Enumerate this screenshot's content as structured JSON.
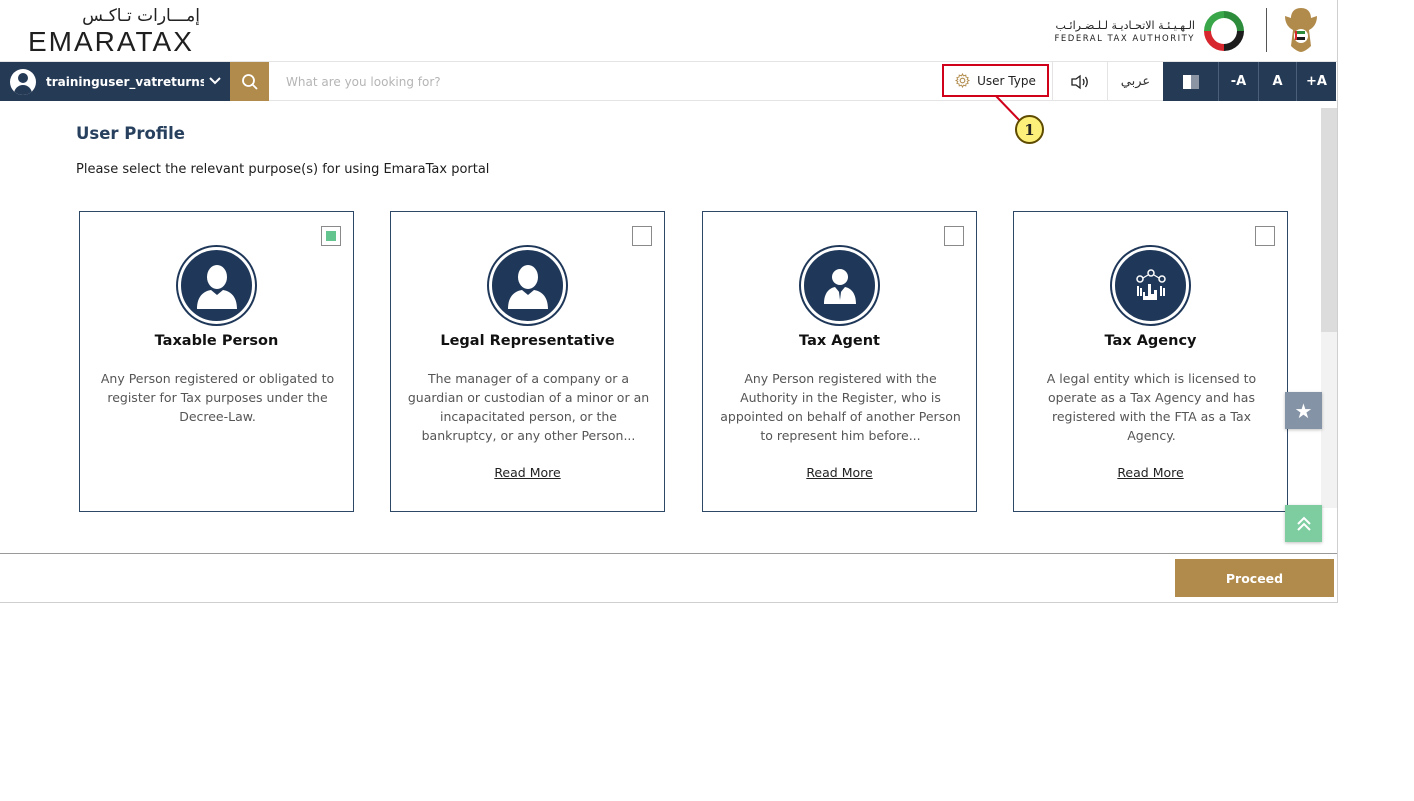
{
  "header": {
    "brand_ar": "إمـــارات تـاكـس",
    "brand_en": "EMARATAX",
    "authority_ar": "الـهـيـئـة الاتحـاديـة لـلـضـرائـب",
    "authority_en": "FEDERAL TAX AUTHORITY"
  },
  "toolbar": {
    "username": "traininguser_vatreturns...",
    "search_placeholder": "What are you looking for?",
    "user_type_label": "User Type",
    "language_label": "عربي",
    "font_decrease": "-A",
    "font_reset": "A",
    "font_increase": "+A"
  },
  "callout": {
    "number": "1"
  },
  "main": {
    "title": "User Profile",
    "subtitle": "Please select the relevant purpose(s) for using EmaraTax portal",
    "cards": [
      {
        "title": "Taxable Person",
        "description": "Any Person registered or obligated to register for Tax purposes under the Decree-Law.",
        "read_more": "",
        "checked": true,
        "icon": "person-icon"
      },
      {
        "title": "Legal Representative",
        "description": "The manager of a company or a guardian or custodian of a minor or an incapacitated person, or the bankruptcy, or any other Person...",
        "read_more": "Read More",
        "checked": false,
        "icon": "person-icon"
      },
      {
        "title": "Tax Agent",
        "description": "Any Person registered with the Authority in the Register, who is appointed on behalf of another Person to represent him before...",
        "read_more": "Read More",
        "checked": false,
        "icon": "agent-icon"
      },
      {
        "title": "Tax Agency",
        "description": "A legal entity which is licensed to operate as a Tax Agency and has registered with the FTA as a Tax Agency.",
        "read_more": "Read More",
        "checked": false,
        "icon": "agency-network-icon"
      }
    ]
  },
  "footer": {
    "proceed_label": "Proceed"
  },
  "colors": {
    "navy": "#253a55",
    "gold": "#b18b4b",
    "checked_green": "#65c58f",
    "highlight_red": "#d0021b"
  }
}
